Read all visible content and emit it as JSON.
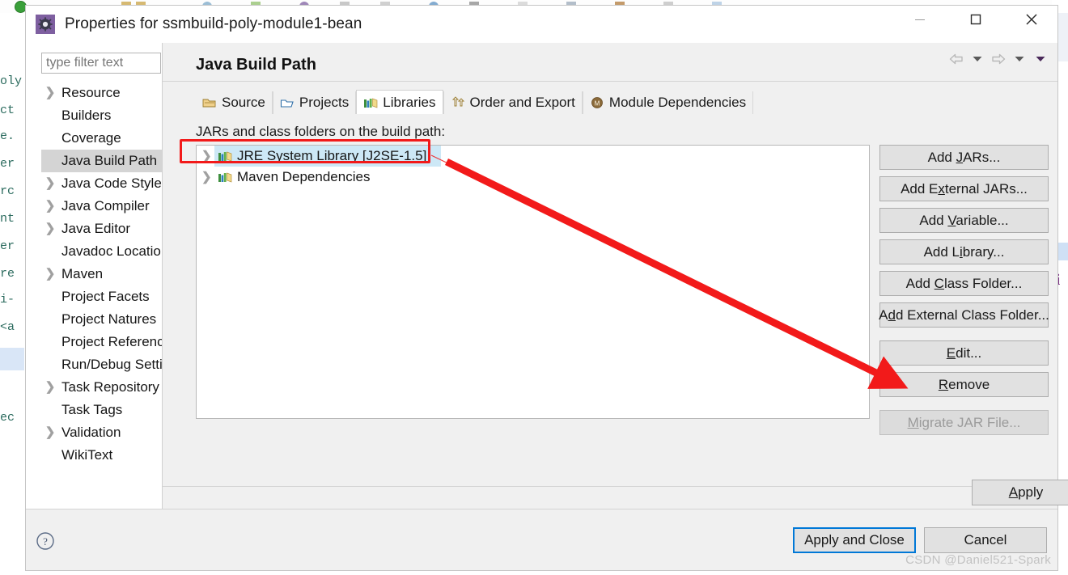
{
  "window": {
    "title": "Properties for ssmbuild-poly-module1-bean",
    "icon": "properties-gear-icon",
    "controls": {
      "minimize": "minimize-icon",
      "maximize": "maximize-icon",
      "close": "close-icon"
    }
  },
  "sidebar": {
    "filter": {
      "placeholder": "type filter text",
      "value": ""
    },
    "items": [
      {
        "label": "Resource",
        "expandable": true,
        "selected": false
      },
      {
        "label": "Builders",
        "expandable": false,
        "selected": false
      },
      {
        "label": "Coverage",
        "expandable": false,
        "selected": false
      },
      {
        "label": "Java Build Path",
        "expandable": false,
        "selected": true
      },
      {
        "label": "Java Code Style",
        "expandable": true,
        "selected": false
      },
      {
        "label": "Java Compiler",
        "expandable": true,
        "selected": false
      },
      {
        "label": "Java Editor",
        "expandable": true,
        "selected": false
      },
      {
        "label": "Javadoc Location",
        "expandable": false,
        "selected": false
      },
      {
        "label": "Maven",
        "expandable": true,
        "selected": false
      },
      {
        "label": "Project Facets",
        "expandable": false,
        "selected": false
      },
      {
        "label": "Project Natures",
        "expandable": false,
        "selected": false
      },
      {
        "label": "Project References",
        "expandable": false,
        "selected": false
      },
      {
        "label": "Run/Debug Settings",
        "expandable": false,
        "selected": false
      },
      {
        "label": "Task Repository",
        "expandable": true,
        "selected": false
      },
      {
        "label": "Task Tags",
        "expandable": false,
        "selected": false
      },
      {
        "label": "Validation",
        "expandable": true,
        "selected": false
      },
      {
        "label": "WikiText",
        "expandable": false,
        "selected": false
      }
    ],
    "hscroll": {
      "left_arrow": "❮",
      "right_arrow": "❯"
    }
  },
  "page": {
    "title": "Java Build Path",
    "nav": {
      "back": "back-arrow-icon",
      "back_menu": "chevron-down-icon",
      "forward": "forward-arrow-icon",
      "forward_menu": "chevron-down-icon",
      "more": "chevron-down-icon"
    },
    "tabs": [
      {
        "label": "Source",
        "icon": "source-folder-icon",
        "active": false
      },
      {
        "label": "Projects",
        "icon": "projects-folder-icon",
        "active": false
      },
      {
        "label": "Libraries",
        "icon": "library-books-icon",
        "active": true
      },
      {
        "label": "Order and Export",
        "icon": "order-export-icon",
        "active": false
      },
      {
        "label": "Module Dependencies",
        "icon": "module-icon",
        "active": false
      }
    ],
    "list_label": "JARs and class folders on the build path:",
    "entries": [
      {
        "label": "JRE System Library [J2SE-1.5]",
        "icon": "library-books-icon",
        "selected": true,
        "expandable": true
      },
      {
        "label": "Maven Dependencies",
        "icon": "library-books-icon",
        "selected": false,
        "expandable": true
      }
    ],
    "buttons": [
      {
        "label": "Add JARs...",
        "mnemonic": "J",
        "disabled": false,
        "gap": false
      },
      {
        "label": "Add External JARs...",
        "mnemonic": "x",
        "disabled": false,
        "gap": false
      },
      {
        "label": "Add Variable...",
        "mnemonic": "V",
        "disabled": false,
        "gap": false
      },
      {
        "label": "Add Library...",
        "mnemonic": "i",
        "disabled": false,
        "gap": false
      },
      {
        "label": "Add Class Folder...",
        "mnemonic": "C",
        "disabled": false,
        "gap": false
      },
      {
        "label": "Add External Class Folder...",
        "mnemonic": "d",
        "disabled": false,
        "gap": false
      },
      {
        "label": "Edit...",
        "mnemonic": "E",
        "disabled": false,
        "gap": true
      },
      {
        "label": "Remove",
        "mnemonic": "R",
        "disabled": false,
        "gap": false
      },
      {
        "label": "Migrate JAR File...",
        "mnemonic": "M",
        "disabled": true,
        "gap": true
      }
    ],
    "apply": {
      "label": "Apply",
      "mnemonic": "A"
    }
  },
  "footer": {
    "help": "help-question-icon",
    "apply_and_close": "Apply and Close",
    "cancel": "Cancel",
    "watermark": "CSDN @Daniel521-Spark"
  },
  "annotation": {
    "highlight_color": "#f21a1a",
    "arrow_color": "#f21a1a",
    "highlight_target": "JRE System Library [J2SE-1.5]",
    "arrow_target": "Remove"
  },
  "theme": {
    "dialog_bg": "#f0f0f0",
    "selection_bg": "#cde8f6",
    "sidebar_selection_bg": "#d4d4d4",
    "default_button_border": "#0078d7",
    "button_bg": "#e1e1e1"
  }
}
